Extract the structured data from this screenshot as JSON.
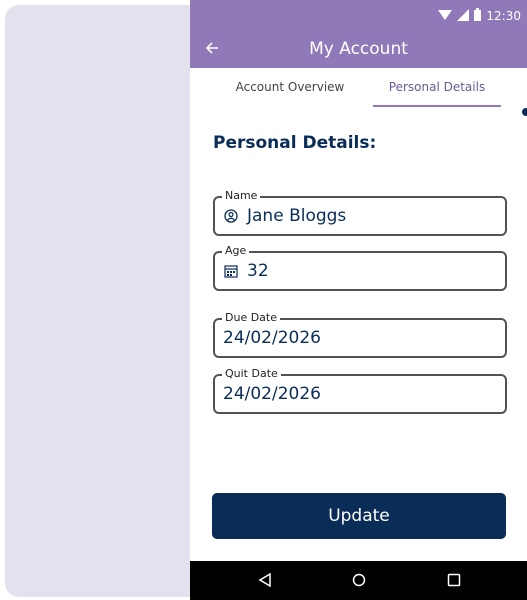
{
  "status_bar": {
    "time": "12:30",
    "icons": [
      "wifi-icon",
      "cell-signal-icon",
      "battery-icon"
    ]
  },
  "app_bar": {
    "title": "My Account",
    "back_icon": "arrow-back-icon"
  },
  "tabs": [
    {
      "label": "Account Overview",
      "selected": false
    },
    {
      "label": "Personal Details",
      "selected": true
    }
  ],
  "section_title": "Personal Details:",
  "fields": [
    {
      "label": "Name",
      "value": "Jane Bloggs",
      "icon": "account-circle-icon"
    },
    {
      "label": "Age",
      "value": "32",
      "icon": "calendar-icon"
    },
    {
      "label": "Due Date",
      "value": "24/02/2026"
    },
    {
      "label": "Quit Date",
      "value": "24/02/2026"
    }
  ],
  "update_button": {
    "label": "Update"
  },
  "nav_bar": {
    "icons": [
      "back-triangle-icon",
      "home-circle-icon",
      "recents-square-icon"
    ]
  },
  "colors": {
    "header": "#8f79b8",
    "navy": "#0a2d57",
    "left_panel": "#e3e1ee"
  }
}
